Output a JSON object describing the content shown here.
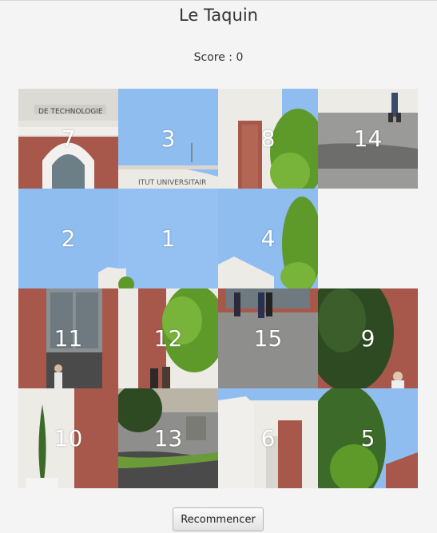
{
  "title": "Le Taquin",
  "score": {
    "label": "Score :",
    "value": "0"
  },
  "tiles": [
    {
      "label": "7",
      "image": "building-sign-arch"
    },
    {
      "label": "3",
      "image": "sky-building-top"
    },
    {
      "label": "8",
      "image": "building-tree"
    },
    {
      "label": "14",
      "image": "pavement-walker"
    },
    {
      "label": "2",
      "image": "sky-roof"
    },
    {
      "label": "1",
      "image": "sky"
    },
    {
      "label": "4",
      "image": "sky-roof-tree"
    },
    {
      "label": "",
      "image": "empty"
    },
    {
      "label": "11",
      "image": "entrance-people"
    },
    {
      "label": "12",
      "image": "brick-tree-people"
    },
    {
      "label": "15",
      "image": "pavement-people"
    },
    {
      "label": "9",
      "image": "tree-brick"
    },
    {
      "label": "10",
      "image": "brick-cypress"
    },
    {
      "label": "13",
      "image": "courtyard-bin"
    },
    {
      "label": "6",
      "image": "white-wall"
    },
    {
      "label": "5",
      "image": "tree-sky-brick"
    }
  ],
  "restart_label": "Recommencer",
  "colors": {
    "sky": "#8fbdf0",
    "brick": "#a8584a",
    "foliage": "#5e9a2a",
    "pavement": "#8e8e8c",
    "wall": "#ecebe6"
  }
}
